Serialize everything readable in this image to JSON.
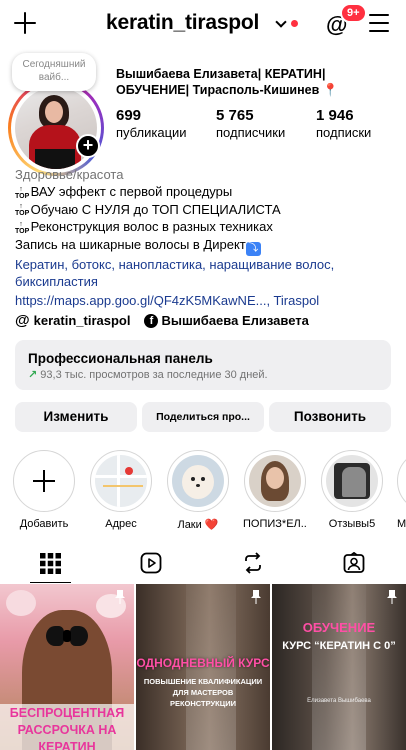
{
  "header": {
    "username": "keratin_tiraspol",
    "notification_badge": "9+",
    "icons": [
      "plus-icon",
      "chevron-down-icon",
      "threads-icon",
      "menu-icon"
    ]
  },
  "profile": {
    "note": "Сегодняшний вайб...",
    "full_name": "Вышибаева Елизавета| КЕРАТИН| ОБУЧЕНИЕ| Тирасполь-Кишинев 📍",
    "stats": [
      {
        "number": "699",
        "label": "публикации"
      },
      {
        "number": "5 765",
        "label": "подписчики"
      },
      {
        "number": "1 946",
        "label": "подписки"
      }
    ]
  },
  "bio": {
    "category": "Здоровье/красота",
    "top_glyph": "TOP",
    "lines": [
      "ВАУ эффект с первой процедуры",
      "Обучаю С НУЛЯ до ТОП СПЕЦИАЛИСТА",
      "Реконструкция волос в разных техниках",
      "Запись на шикарные волосы в Директ"
    ],
    "enter_key": "⤵",
    "hashtags": "Кератин, ботокс, нанопластика, наращивание волос, биксипластия",
    "link": "https://maps.app.goo.gl/QF4zK5MKawNE..., Tiraspol"
  },
  "linked": {
    "threads_handle": "keratin_tiraspol",
    "facebook_name": "Вышибаева Елизавета"
  },
  "dashboard": {
    "title": "Профессиональная панель",
    "subtitle": "93,3 тыс. просмотров за последние 30 дней."
  },
  "buttons": {
    "edit": "Изменить",
    "share": "Поделиться про...",
    "call": "Позвонить"
  },
  "highlights": [
    {
      "label": "Добавить"
    },
    {
      "label": "Адрес"
    },
    {
      "label": "Лаки ❤️"
    },
    {
      "label": "ПОПИЗ*ЕЛ..."
    },
    {
      "label": "Отзывы5"
    },
    {
      "label": "М"
    }
  ],
  "tabs": [
    "grid-icon",
    "reels-icon",
    "reposts-icon",
    "tagged-icon"
  ],
  "posts": [
    {
      "caption": "БЕСПРОЦЕНТНАЯ РАССРОЧКА НА КЕРАТИН"
    },
    {
      "caption": "ОДНОДНЕВНЫЙ КУРС",
      "subcaption": "ПОВЫШЕНИЕ КВАЛИФИКАЦИИ ДЛЯ МАСТЕРОВ РЕКОНСТРУКЦИИ"
    },
    {
      "caption": "ОБУЧЕНИЕ",
      "subcaption": "КУРС “КЕРАТИН С 0”",
      "author": "Елизавета Вышибаева"
    }
  ],
  "colors": {
    "badge": "#ff3040",
    "link": "#1a3a8f",
    "button_bg": "#efeff1",
    "trend_arrow": "#2fa84f",
    "post_caption_pink": "#e8369c"
  }
}
